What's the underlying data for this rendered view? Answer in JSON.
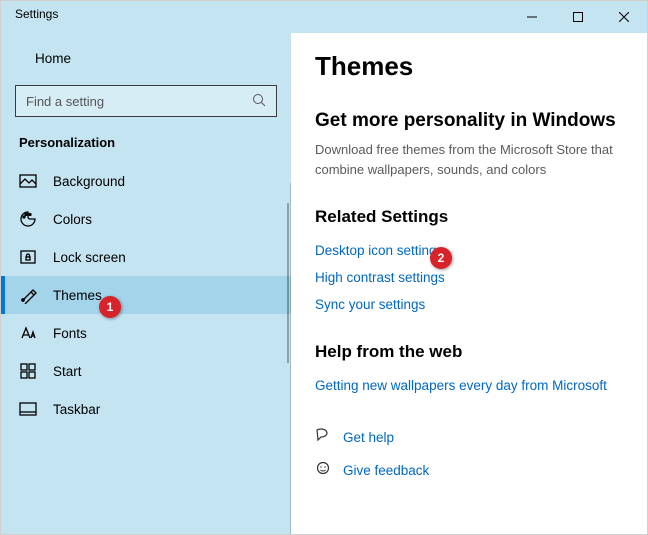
{
  "window": {
    "title": "Settings"
  },
  "sidebar": {
    "home": "Home",
    "search_placeholder": "Find a setting",
    "section": "Personalization",
    "items": [
      {
        "label": "Background"
      },
      {
        "label": "Colors"
      },
      {
        "label": "Lock screen"
      },
      {
        "label": "Themes"
      },
      {
        "label": "Fonts"
      },
      {
        "label": "Start"
      },
      {
        "label": "Taskbar"
      }
    ]
  },
  "main": {
    "title": "Themes",
    "personality_heading": "Get more personality in Windows",
    "personality_sub": "Download free themes from the Microsoft Store that combine wallpapers, sounds, and colors",
    "related_heading": "Related Settings",
    "related_links": [
      "Desktop icon settings",
      "High contrast settings",
      "Sync your settings"
    ],
    "help_heading": "Help from the web",
    "help_link": "Getting new wallpapers every day from Microsoft",
    "get_help": "Get help",
    "give_feedback": "Give feedback"
  },
  "badges": {
    "b1": "1",
    "b2": "2"
  }
}
